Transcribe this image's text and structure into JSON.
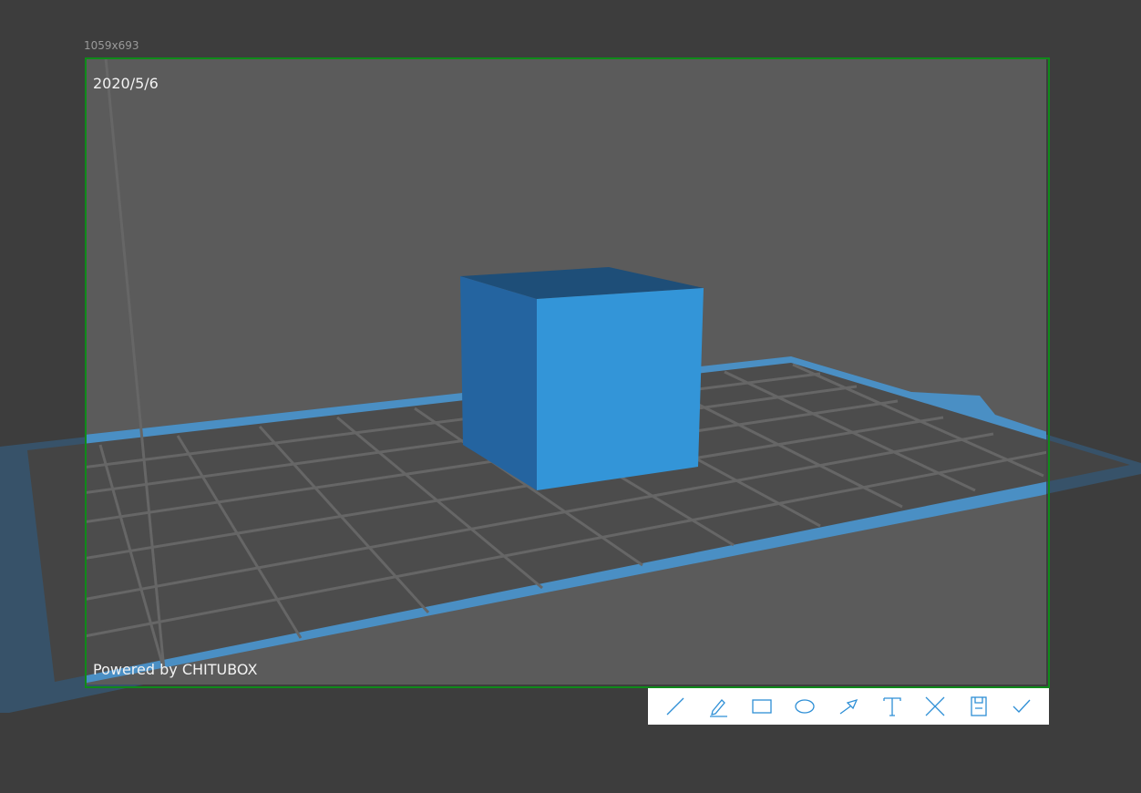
{
  "capture": {
    "size_label": "1059x693",
    "date_label": "2020/5/6",
    "powered_label": "Powered by CHITUBOX"
  },
  "colors": {
    "background": "#3d3d3d",
    "frame_border": "#0f8a1a",
    "build_plate_edge": "#4a8fc4",
    "cube_front": "#3395d8",
    "cube_side": "#2464a0",
    "cube_top": "#1e4e78",
    "toolbar_icon": "#2e8fd6"
  },
  "toolbar": {
    "tools": [
      {
        "name": "line-tool",
        "icon": "line-icon"
      },
      {
        "name": "pen-tool",
        "icon": "pen-icon"
      },
      {
        "name": "rectangle-tool",
        "icon": "rectangle-icon"
      },
      {
        "name": "ellipse-tool",
        "icon": "ellipse-icon"
      },
      {
        "name": "arrow-tool",
        "icon": "arrow-icon"
      },
      {
        "name": "text-tool",
        "icon": "text-icon"
      },
      {
        "name": "cancel-tool",
        "icon": "close-icon"
      },
      {
        "name": "save-tool",
        "icon": "save-icon"
      },
      {
        "name": "confirm-tool",
        "icon": "check-icon"
      }
    ]
  }
}
